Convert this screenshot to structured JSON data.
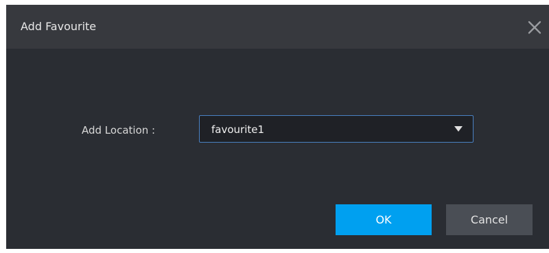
{
  "dialog": {
    "title": "Add Favourite",
    "close_icon": "close-icon",
    "location_label": "Add Location :",
    "location_select": {
      "value": "favourite1",
      "caret_icon": "caret-down-icon"
    },
    "ok_label": "OK",
    "cancel_label": "Cancel"
  },
  "colors": {
    "dialog_bg": "#2a2d33",
    "titlebar_bg": "#37393e",
    "select_border": "#4a82c4",
    "ok_button": "#00a0f0",
    "cancel_button": "#4a4e55"
  }
}
